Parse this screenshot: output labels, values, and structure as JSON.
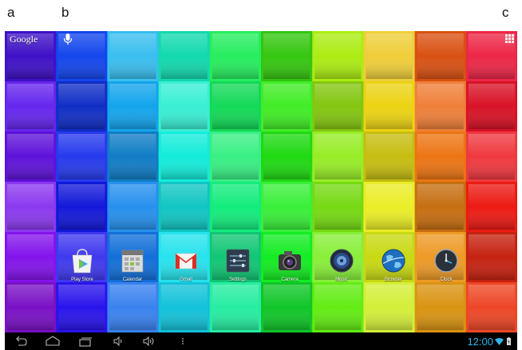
{
  "callouts": {
    "a": "a",
    "b": "b",
    "c": "c"
  },
  "search_bar": {
    "google_label": "Google",
    "mic_icon": "microphone-icon"
  },
  "apps_drawer_icon": "apps-grid-icon",
  "dock": [
    {
      "label": "Play Store",
      "icon": "play-store-icon"
    },
    {
      "label": "Calendar",
      "icon": "calendar-icon"
    },
    {
      "label": "Gmail",
      "icon": "gmail-icon"
    },
    {
      "label": "Settings",
      "icon": "settings-icon"
    },
    {
      "label": "Camera",
      "icon": "camera-icon"
    },
    {
      "label": "Music",
      "icon": "music-icon"
    },
    {
      "label": "Browser",
      "icon": "browser-icon"
    },
    {
      "label": "Clock",
      "icon": "clock-icon"
    }
  ],
  "navbar": {
    "buttons": [
      "back-icon",
      "home-icon",
      "recent-apps-icon",
      "volume-down-icon",
      "volume-up-icon",
      "menu-icon"
    ],
    "time": "12:00"
  },
  "colors": {
    "clock": "#33b5e5",
    "navbar": "#000000"
  }
}
